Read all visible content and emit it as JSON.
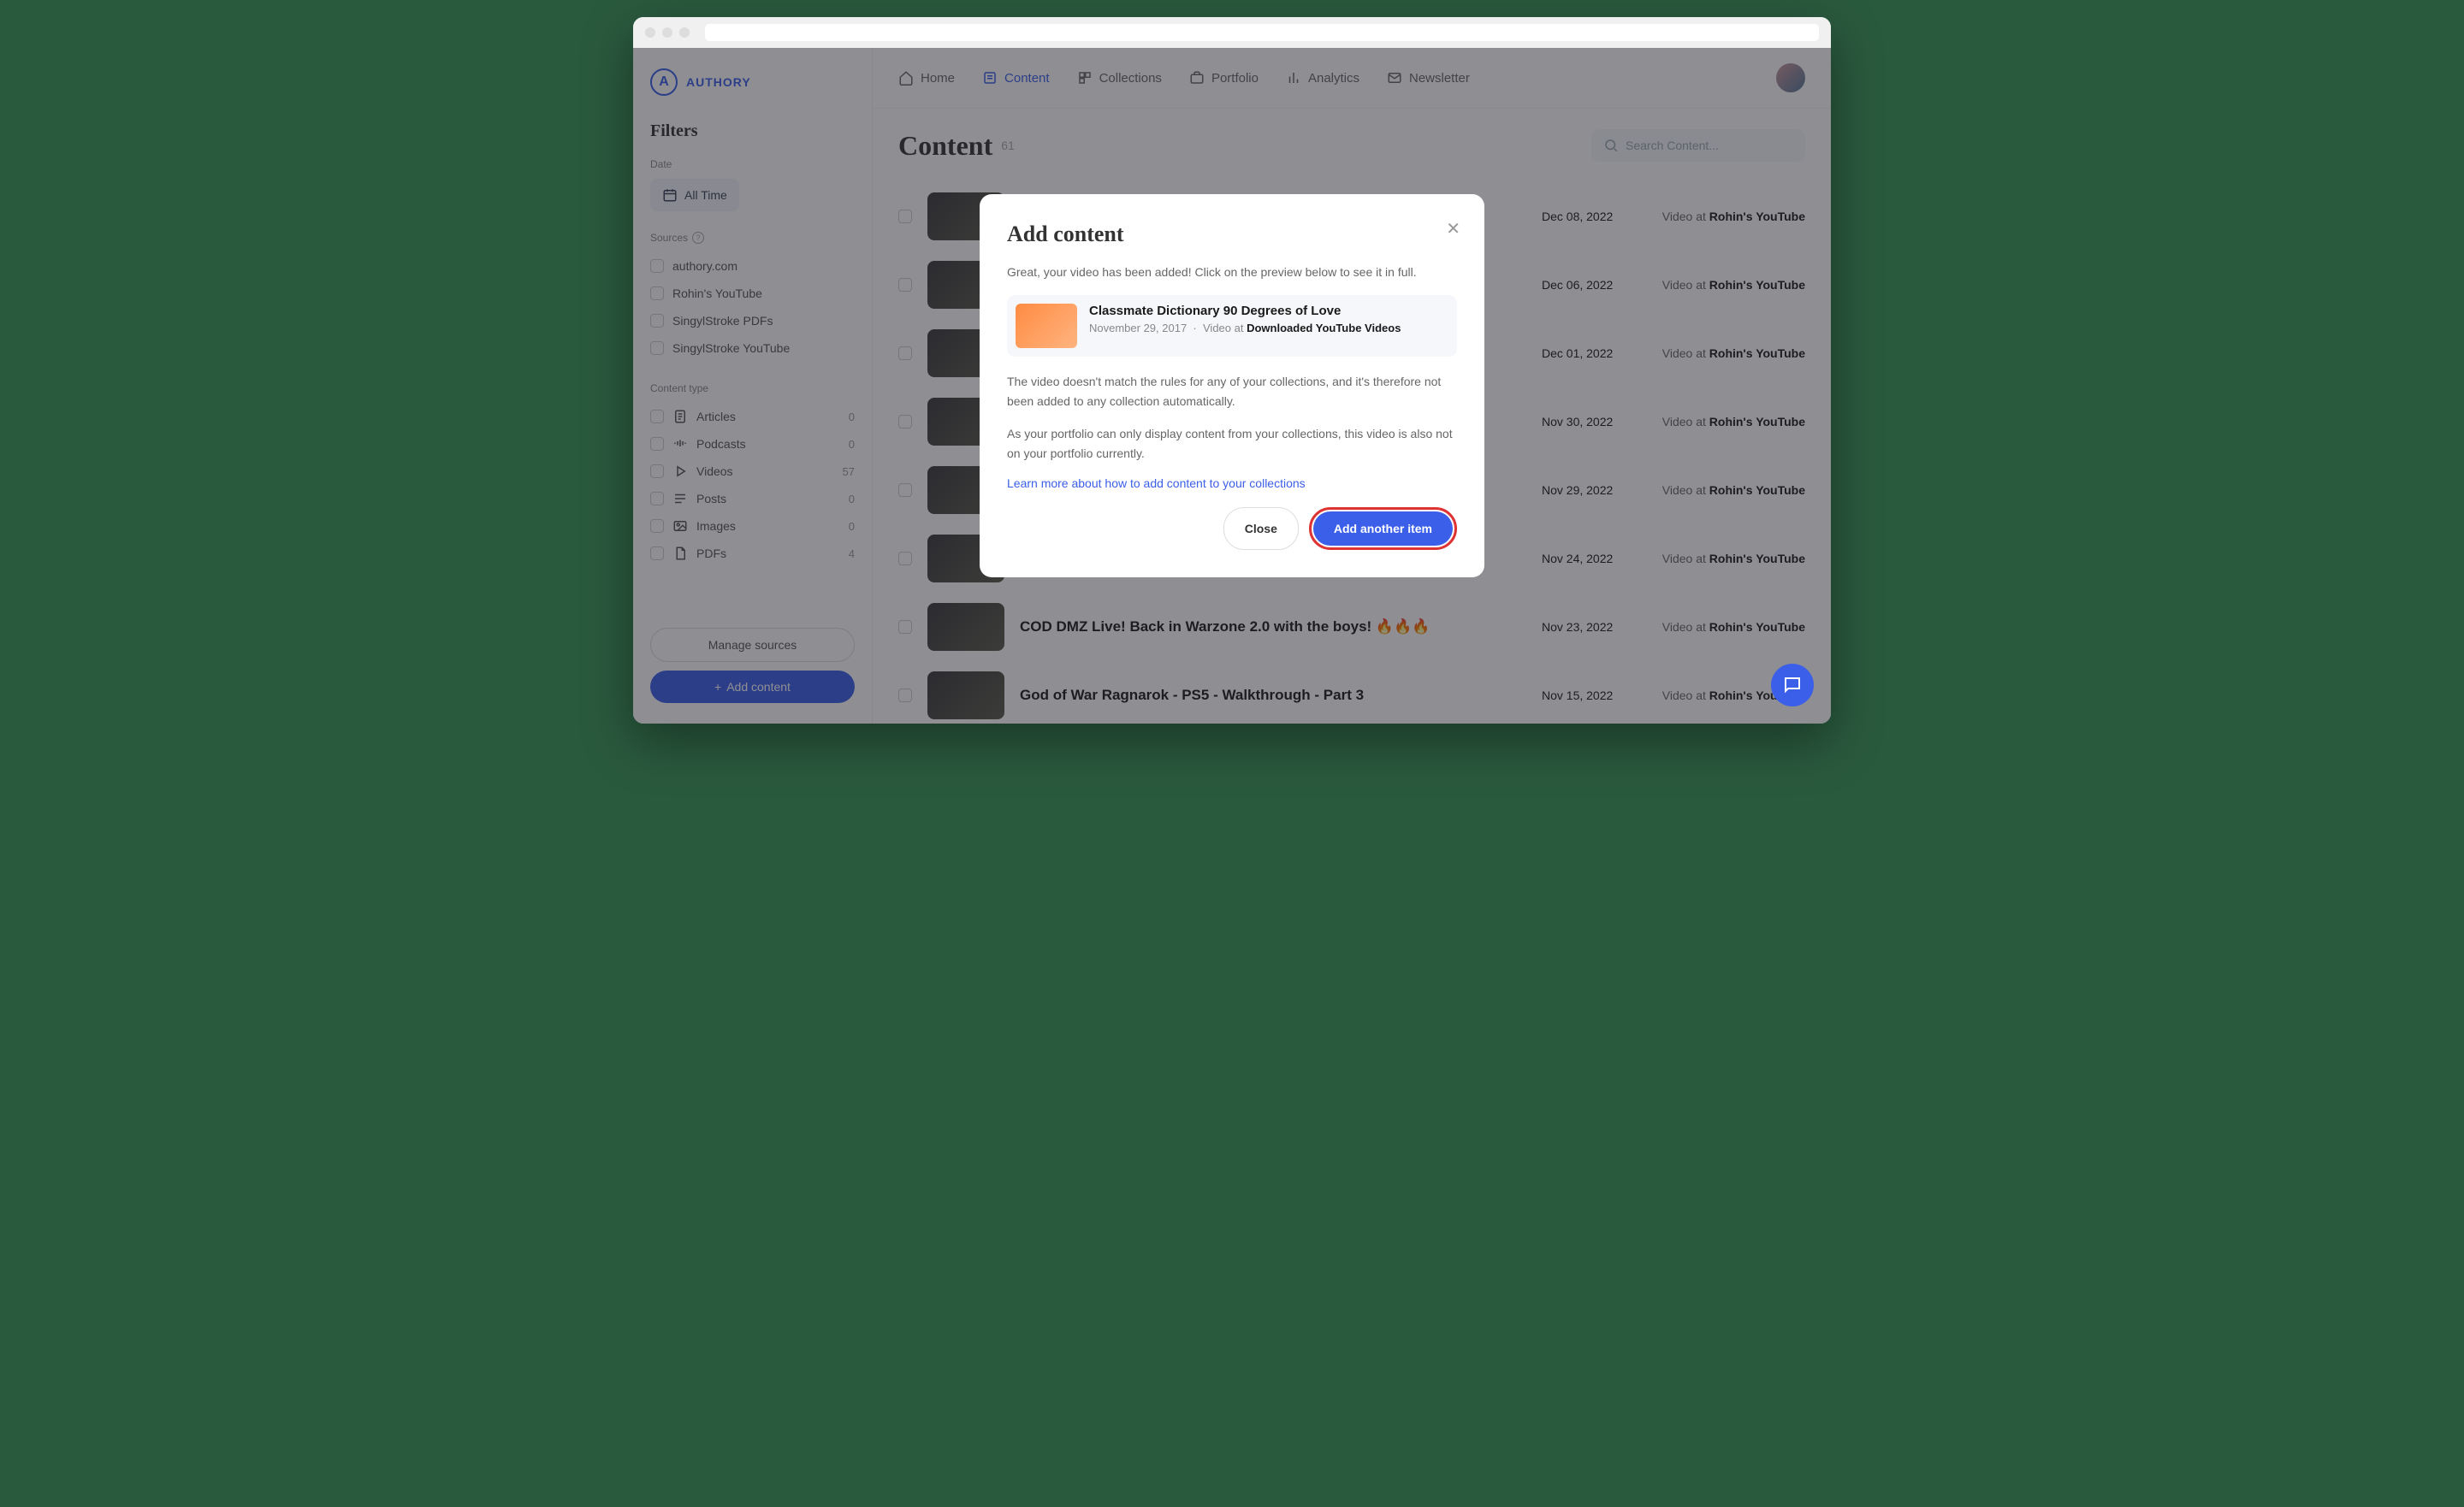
{
  "brand": "AUTHORY",
  "nav": {
    "home": "Home",
    "content": "Content",
    "collections": "Collections",
    "portfolio": "Portfolio",
    "analytics": "Analytics",
    "newsletter": "Newsletter"
  },
  "filters": {
    "title": "Filters",
    "date_label": "Date",
    "all_time": "All Time",
    "sources_label": "Sources",
    "sources": [
      "authory.com",
      "Rohin's YouTube",
      "SingylStroke PDFs",
      "SingylStroke YouTube"
    ],
    "content_type_label": "Content type",
    "types": [
      {
        "name": "Articles",
        "count": "0"
      },
      {
        "name": "Podcasts",
        "count": "0"
      },
      {
        "name": "Videos",
        "count": "57"
      },
      {
        "name": "Posts",
        "count": "0"
      },
      {
        "name": "Images",
        "count": "0"
      },
      {
        "name": "PDFs",
        "count": "4"
      }
    ],
    "manage": "Manage sources",
    "add": "Add content"
  },
  "page": {
    "title": "Content",
    "count": "61",
    "search_placeholder": "Search Content..."
  },
  "rows": [
    {
      "title": "",
      "date": "Dec 08, 2022",
      "src_pre": "Video at ",
      "src": "Rohin's YouTube"
    },
    {
      "title": "",
      "date": "Dec 06, 2022",
      "src_pre": "Video at ",
      "src": "Rohin's YouTube"
    },
    {
      "title": "",
      "date": "Dec 01, 2022",
      "src_pre": "Video at ",
      "src": "Rohin's YouTube"
    },
    {
      "title": "",
      "date": "Nov 30, 2022",
      "src_pre": "Video at ",
      "src": "Rohin's YouTube"
    },
    {
      "title": "",
      "date": "Nov 29, 2022",
      "src_pre": "Video at ",
      "src": "Rohin's YouTube"
    },
    {
      "title": "",
      "date": "Nov 24, 2022",
      "src_pre": "Video at ",
      "src": "Rohin's YouTube"
    },
    {
      "title": "COD DMZ Live! Back in Warzone 2.0 with the boys! 🔥🔥🔥",
      "date": "Nov 23, 2022",
      "src_pre": "Video at ",
      "src": "Rohin's YouTube"
    },
    {
      "title": "God of War Ragnarok - PS5 - Walkthrough - Part 3",
      "date": "Nov 15, 2022",
      "src_pre": "Video at ",
      "src": "Rohin's YouTube"
    }
  ],
  "modal": {
    "title": "Add content",
    "intro": "Great, your video has been added! Click on the preview below to see it in full.",
    "preview_title": "Classmate Dictionary 90 Degrees of Love",
    "preview_date": "November 29, 2017",
    "preview_sep": "·",
    "preview_type": "Video at ",
    "preview_source": "Downloaded YouTube Videos",
    "p1": "The video doesn't match the rules for any of your collections, and it's therefore not been added to any collection automatically.",
    "p2": "As your portfolio can only display content from your collections, this video is also not on your portfolio currently.",
    "link": "Learn more about how to add content to your collections",
    "close": "Close",
    "another": "Add another item"
  }
}
